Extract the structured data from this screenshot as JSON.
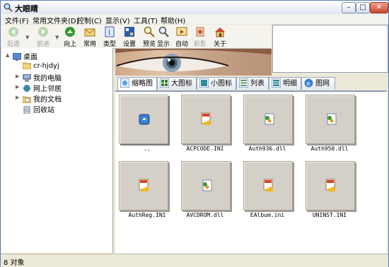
{
  "window": {
    "title": "大眼睛"
  },
  "window_controls": {
    "minimize": "–",
    "maximize": "□",
    "close": "✕"
  },
  "menu": [
    "文件(F)",
    "常用文件夹(D)",
    "控制(C)",
    "显示(V)",
    "工具(T)",
    "帮助(H)"
  ],
  "toolbar": {
    "back": "后退",
    "forward": "前进",
    "up": "向上",
    "common": "常用",
    "type": "类型",
    "settings": "设置",
    "preview": "预览",
    "display": "显示",
    "auto": "自动",
    "color": "彩影",
    "about": "关于"
  },
  "tree": {
    "desktop": "桌面",
    "folder": "cr-hjdyj",
    "my_computer": "我的电脑",
    "network": "网上邻居",
    "my_documents": "我的文档",
    "recycle_bin": "回收站"
  },
  "tabs": [
    "缩略图",
    "大图标",
    "小图标",
    "列表",
    "明细",
    "图网"
  ],
  "files": [
    {
      "name": "..",
      "icon": "up-folder-icon"
    },
    {
      "name": "ACPCODE.INI",
      "icon": "ini-file-icon"
    },
    {
      "name": "Auth936.dll",
      "icon": "dll-file-icon"
    },
    {
      "name": "Auth950.dll",
      "icon": "dll-file-icon"
    },
    {
      "name": "AuthReg.INI",
      "icon": "ini-file-icon"
    },
    {
      "name": "AVCDROM.dll",
      "icon": "dll-file-icon"
    },
    {
      "name": "EAlbum.ini",
      "icon": "ini-file-icon"
    },
    {
      "name": "UNINST.INI",
      "icon": "ini-file-icon"
    }
  ],
  "status": {
    "count": "8 对象"
  }
}
